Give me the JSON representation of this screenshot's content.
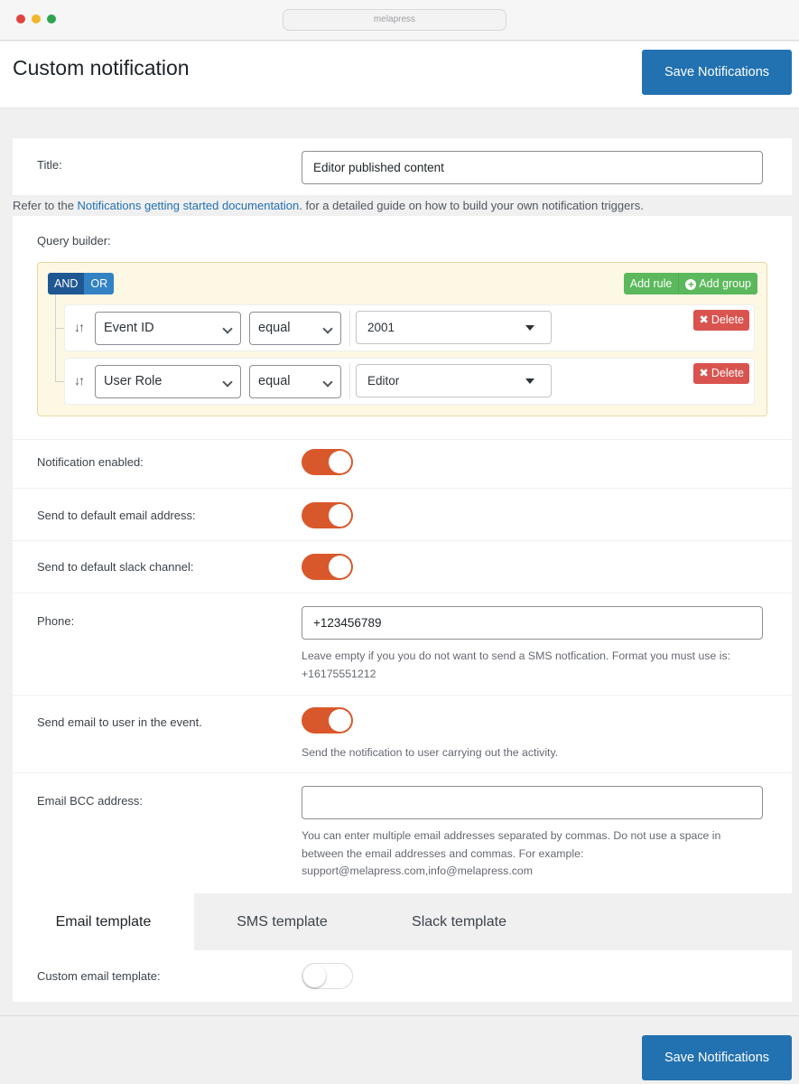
{
  "browser": {
    "url": "melapress"
  },
  "header": {
    "title": "Custom notification",
    "save_label": "Save Notifications"
  },
  "form": {
    "title": {
      "label": "Title:",
      "value": "Editor published content"
    },
    "refer": {
      "prefix": "Refer to the ",
      "link": "Notifications getting started documentation",
      "suffix": ". for a detailed guide on how to build your own notification triggers."
    },
    "query_builder": {
      "label": "Query builder:",
      "and_label": "AND",
      "or_label": "OR",
      "add_rule_label": "Add rule",
      "add_group_label": "Add group",
      "rules": [
        {
          "field": "Event ID",
          "operator": "equal",
          "value": "2001",
          "delete_label": "Delete"
        },
        {
          "field": "User Role",
          "operator": "equal",
          "value": "Editor",
          "delete_label": "Delete"
        }
      ]
    },
    "notification_enabled": {
      "label": "Notification enabled:",
      "on": true
    },
    "default_email": {
      "label": "Send to default email address:",
      "on": true
    },
    "default_slack": {
      "label": "Send to default slack channel:",
      "on": true
    },
    "phone": {
      "label": "Phone:",
      "value": "+123456789",
      "help": "Leave empty if you you do not want to send a SMS notfication. Format you must use is: +16175551212"
    },
    "email_user": {
      "label": "Send email to user in the event.",
      "on": true,
      "help": "Send the notification to user carrying out the activity."
    },
    "bcc": {
      "label": "Email BCC address:",
      "value": "",
      "help": "You can enter multiple email addresses separated by commas. Do not use a space in between the email addresses and commas. For example: support@melapress.com,info@melapress.com"
    }
  },
  "tabs": [
    {
      "label": "Email template",
      "active": true
    },
    {
      "label": "SMS template",
      "active": false
    },
    {
      "label": "Slack template",
      "active": false
    }
  ],
  "custom_template": {
    "label": "Custom email template:",
    "on": false
  },
  "footer": {
    "save_label": "Save Notifications"
  },
  "colors": {
    "primary": "#2271b1",
    "toggle_on": "#d9582b",
    "add": "#5cb85c",
    "delete": "#d9534f",
    "query_bg": "#fcf8e3"
  }
}
